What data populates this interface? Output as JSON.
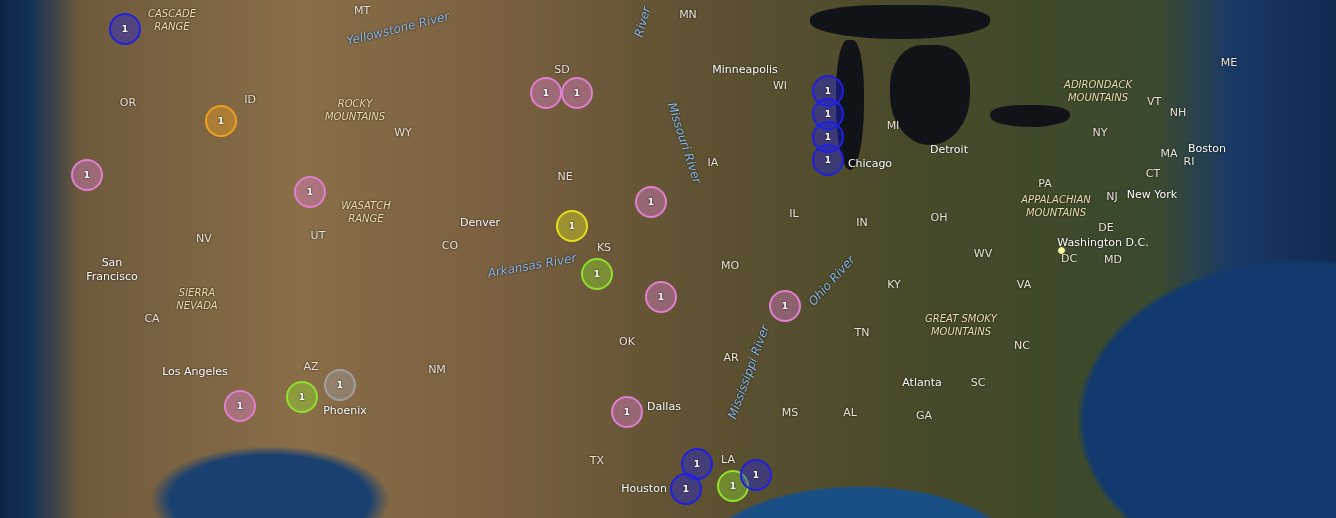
{
  "map": {
    "labels": [
      {
        "kind": "region",
        "text": "CASCADE RANGE"
      },
      {
        "kind": "state",
        "text": "MT"
      },
      {
        "kind": "river",
        "text": "Yellowstone River"
      },
      {
        "kind": "river",
        "text": "River"
      },
      {
        "kind": "state",
        "text": "MN"
      },
      {
        "kind": "city",
        "text": "Minneapolis"
      },
      {
        "kind": "state",
        "text": "WI"
      },
      {
        "kind": "state",
        "text": "ME"
      },
      {
        "kind": "state",
        "text": "OR"
      },
      {
        "kind": "state",
        "text": "ID"
      },
      {
        "kind": "region",
        "text": "ROCKY MOUNTAINS"
      },
      {
        "kind": "state",
        "text": "WY"
      },
      {
        "kind": "state",
        "text": "SD"
      },
      {
        "kind": "region",
        "text": "ADIRONDACK MOUNTAINS"
      },
      {
        "kind": "state",
        "text": "VT"
      },
      {
        "kind": "state",
        "text": "NH"
      },
      {
        "kind": "state",
        "text": "NY"
      },
      {
        "kind": "state",
        "text": "MI"
      },
      {
        "kind": "state",
        "text": "MA"
      },
      {
        "kind": "state",
        "text": "RI"
      },
      {
        "kind": "city",
        "text": "Detroit"
      },
      {
        "kind": "city",
        "text": "Boston"
      },
      {
        "kind": "state",
        "text": "IA"
      },
      {
        "kind": "city",
        "text": "Chicago"
      },
      {
        "kind": "river",
        "text": "Missouri River"
      },
      {
        "kind": "state",
        "text": "CT"
      },
      {
        "kind": "state",
        "text": "NE"
      },
      {
        "kind": "state",
        "text": "PA"
      },
      {
        "kind": "region",
        "text": "APPALACHIAN MOUNTAINS"
      },
      {
        "kind": "state",
        "text": "NJ"
      },
      {
        "kind": "city",
        "text": "New York"
      },
      {
        "kind": "region",
        "text": "WASATCH RANGE"
      },
      {
        "kind": "city",
        "text": "Denver"
      },
      {
        "kind": "state",
        "text": "IL"
      },
      {
        "kind": "state",
        "text": "OH"
      },
      {
        "kind": "state",
        "text": "IN"
      },
      {
        "kind": "state",
        "text": "DE"
      },
      {
        "kind": "state",
        "text": "UT"
      },
      {
        "kind": "state",
        "text": "NV"
      },
      {
        "kind": "state",
        "text": "CO"
      },
      {
        "kind": "city",
        "text": "Washington D.C."
      },
      {
        "kind": "state",
        "text": "WV"
      },
      {
        "kind": "state",
        "text": "DC"
      },
      {
        "kind": "state",
        "text": "MD"
      },
      {
        "kind": "state",
        "text": "KS"
      },
      {
        "kind": "river",
        "text": "Arkansas River"
      },
      {
        "kind": "state",
        "text": "MO"
      },
      {
        "kind": "city",
        "text": "San Francisco"
      },
      {
        "kind": "river",
        "text": "Ohio River"
      },
      {
        "kind": "state",
        "text": "KY"
      },
      {
        "kind": "state",
        "text": "VA"
      },
      {
        "kind": "region",
        "text": "SIERRA NEVADA"
      },
      {
        "kind": "state",
        "text": "CA"
      },
      {
        "kind": "state",
        "text": "TN"
      },
      {
        "kind": "region",
        "text": "GREAT SMOKY MOUNTAINS"
      },
      {
        "kind": "river",
        "text": "Mississippi River"
      },
      {
        "kind": "state",
        "text": "OK"
      },
      {
        "kind": "state",
        "text": "NC"
      },
      {
        "kind": "state",
        "text": "AR"
      },
      {
        "kind": "city",
        "text": "Los Angeles"
      },
      {
        "kind": "state",
        "text": "AZ"
      },
      {
        "kind": "state",
        "text": "NM"
      },
      {
        "kind": "city",
        "text": "Atlanta"
      },
      {
        "kind": "state",
        "text": "SC"
      },
      {
        "kind": "city",
        "text": "Phoenix"
      },
      {
        "kind": "city",
        "text": "Dallas"
      },
      {
        "kind": "state",
        "text": "MS"
      },
      {
        "kind": "state",
        "text": "AL"
      },
      {
        "kind": "state",
        "text": "GA"
      },
      {
        "kind": "state",
        "text": "TX"
      },
      {
        "kind": "state",
        "text": "LA"
      },
      {
        "kind": "city",
        "text": "Houston"
      }
    ],
    "markers": [
      {
        "count": "1",
        "color": "#2020e0"
      },
      {
        "count": "1",
        "color": "#f0a020"
      },
      {
        "count": "1",
        "color": "#e080d0"
      },
      {
        "count": "1",
        "color": "#e080d0"
      },
      {
        "count": "1",
        "color": "#e080d0"
      },
      {
        "count": "1",
        "color": "#e080d0"
      },
      {
        "count": "1",
        "color": "#e0e020"
      },
      {
        "count": "1",
        "color": "#e080d0"
      },
      {
        "count": "1",
        "color": "#90e030"
      },
      {
        "count": "1",
        "color": "#e080d0"
      },
      {
        "count": "1",
        "color": "#e080d0"
      },
      {
        "count": "1",
        "color": "#2020e0"
      },
      {
        "count": "1",
        "color": "#2020e0"
      },
      {
        "count": "1",
        "color": "#2020e0"
      },
      {
        "count": "1",
        "color": "#2020e0"
      },
      {
        "count": "1",
        "color": "#a0a0a0"
      },
      {
        "count": "1",
        "color": "#90e030"
      },
      {
        "count": "1",
        "color": "#e080d0"
      },
      {
        "count": "1",
        "color": "#e080d0"
      },
      {
        "count": "1",
        "color": "#2020e0"
      },
      {
        "count": "1",
        "color": "#2020e0"
      },
      {
        "count": "1",
        "color": "#90e030"
      },
      {
        "count": "1",
        "color": "#2020e0"
      }
    ]
  }
}
